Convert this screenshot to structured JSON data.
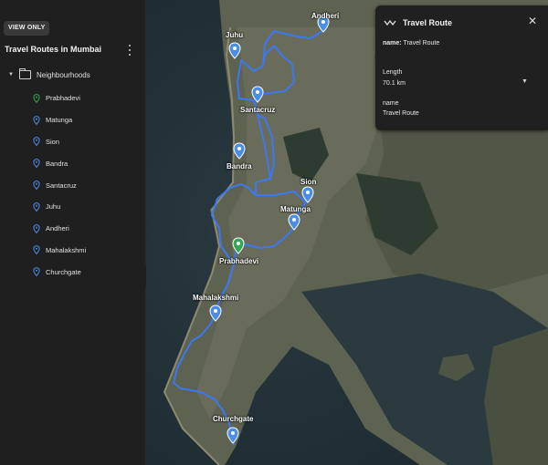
{
  "sidebar": {
    "badge": "VIEW ONLY",
    "project_title": "Travel Routes in Mumbai",
    "folder": "Neighbourhoods",
    "items": [
      {
        "label": "Prabhadevi",
        "color": "#34a853"
      },
      {
        "label": "Matunga",
        "color": "#4a8fe7"
      },
      {
        "label": "Sion",
        "color": "#4a8fe7"
      },
      {
        "label": "Bandra",
        "color": "#4a8fe7"
      },
      {
        "label": "Santacruz",
        "color": "#4a8fe7"
      },
      {
        "label": "Juhu",
        "color": "#4a8fe7"
      },
      {
        "label": "Andheri",
        "color": "#4a8fe7"
      },
      {
        "label": "Mahalakshmi",
        "color": "#4a8fe7"
      },
      {
        "label": "Churchgate",
        "color": "#4a8fe7"
      }
    ]
  },
  "map": {
    "labels": {
      "andheri": "Andheri",
      "juhu": "Juhu",
      "santacruz": "Santacruz",
      "bandra": "Bandra",
      "sion": "Sion",
      "matunga": "Matunga",
      "prabhadevi": "Prabhadevi",
      "mahalakshmi": "Mahalakshmi",
      "churchgate": "Churchgate"
    },
    "route_color": "#3b78f2"
  },
  "card": {
    "title": "Travel Route",
    "name_key": "name:",
    "name_value": "Travel Route",
    "length_label": "Length",
    "length_value": "70.1 km",
    "name_label": "name",
    "name_field_value": "Travel Route"
  }
}
